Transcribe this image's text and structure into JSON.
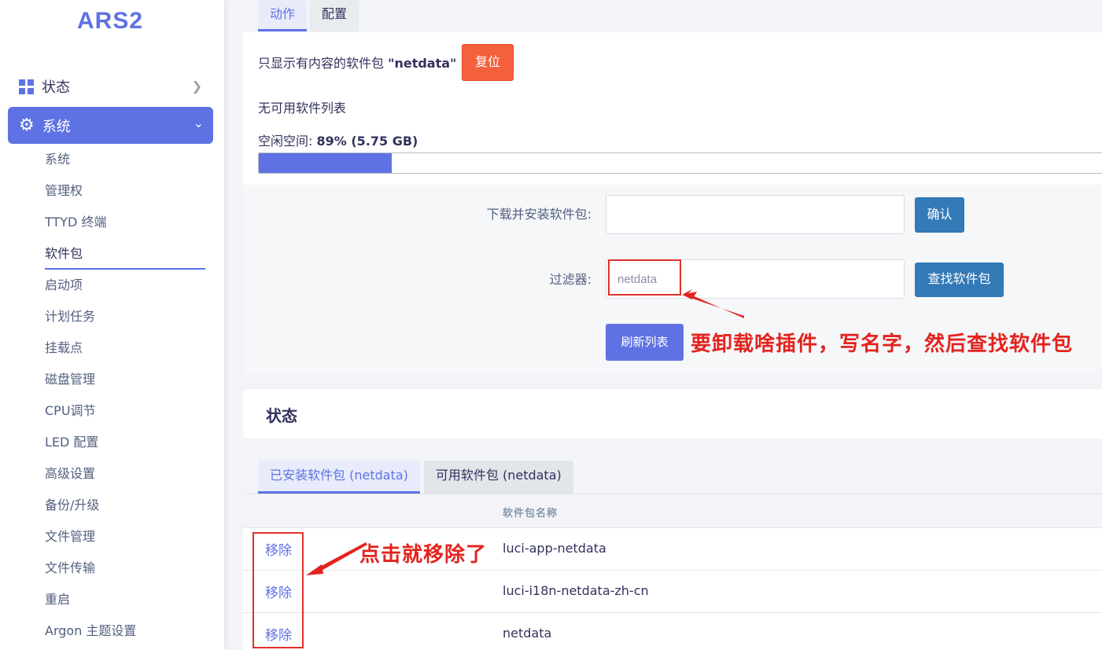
{
  "sidebar": {
    "logo": "ARS2",
    "status_label": "状态",
    "system_label": "系统",
    "sub_items": [
      "系统",
      "管理权",
      "TTYD 终端",
      "软件包",
      "启动项",
      "计划任务",
      "挂载点",
      "磁盘管理",
      "CPU调节",
      "LED 配置",
      "高级设置",
      "备份/升级",
      "文件管理",
      "文件传输",
      "重启",
      "Argon 主题设置"
    ],
    "active_item": "软件包"
  },
  "top_tabs": [
    "动作",
    "配置"
  ],
  "filter_notice": {
    "prefix": "只显示有内容的软件包",
    "name": "\"netdata\""
  },
  "reset_button": "复位",
  "no_list_text": "无可用软件列表",
  "free_space": {
    "label": "空闲空间:",
    "value": "89% (5.75 GB)",
    "used_fraction": 0.158
  },
  "download": {
    "label": "下载并安装软件包:",
    "value": "",
    "confirm_button": "确认"
  },
  "filter": {
    "label": "过滤器:",
    "value": "netdata",
    "find_button": "查找软件包"
  },
  "refresh_button": "刷新列表",
  "annotations": {
    "filter_hint": "要卸载啥插件，写名字，然后查找软件包",
    "remove_hint": "点击就移除了"
  },
  "status_section": {
    "title": "状态",
    "tabs": [
      "已安装软件包 (netdata)",
      "可用软件包 (netdata)"
    ],
    "table_header": "软件包名称",
    "rows": [
      {
        "action": "移除",
        "name": "luci-app-netdata"
      },
      {
        "action": "移除",
        "name": "luci-i18n-netdata-zh-cn"
      },
      {
        "action": "移除",
        "name": "netdata"
      }
    ]
  },
  "colors": {
    "accent": "#5e72e4",
    "reset": "#f5603c",
    "primary_button": "#337ab7",
    "annotation": "#e3231e"
  }
}
